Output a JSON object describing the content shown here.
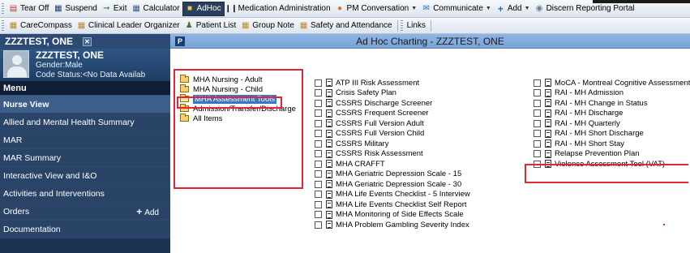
{
  "toolbar1": {
    "items": [
      {
        "label": "Tear Off",
        "icon": "tear-off-icon"
      },
      {
        "label": "Suspend",
        "icon": "suspend-icon"
      },
      {
        "label": "Exit",
        "icon": "exit-icon"
      },
      {
        "label": "Calculator",
        "icon": "calculator-icon"
      },
      {
        "label": "AdHoc",
        "icon": "adhoc-icon"
      },
      {
        "label": "Medication Administration",
        "icon": "barcode-icon"
      },
      {
        "label": "PM Conversation",
        "icon": "person-icon"
      },
      {
        "label": "Communicate",
        "icon": "envelope-icon"
      },
      {
        "label": "Add",
        "icon": "plus-icon"
      },
      {
        "label": "Discern Reporting Portal",
        "icon": "portal-icon"
      }
    ]
  },
  "toolbar2": {
    "items": [
      {
        "label": "CareCompass",
        "icon": "grid-icon"
      },
      {
        "label": "Clinical Leader Organizer",
        "icon": "grid-icon"
      },
      {
        "label": "Patient List",
        "icon": "patient-list-icon"
      },
      {
        "label": "Group Note",
        "icon": "grid-icon"
      },
      {
        "label": "Safety and Attendance",
        "icon": "grid-icon"
      }
    ],
    "links_label": "Links"
  },
  "patient": {
    "tab_name": "ZZZTEST, ONE",
    "name": "ZZZTEST, ONE",
    "gender": "Gender:Male",
    "code_status": "Code Status:<No Data Availab"
  },
  "menu": {
    "header": "Menu",
    "items": [
      {
        "label": "Nurse View",
        "selected": true
      },
      {
        "label": "Allied and Mental Health Summary"
      },
      {
        "label": "MAR"
      },
      {
        "label": "MAR Summary"
      },
      {
        "label": "Interactive View and I&O"
      },
      {
        "label": "Activities and Interventions"
      },
      {
        "label": "Orders",
        "action": "Add"
      },
      {
        "label": "Documentation"
      }
    ]
  },
  "main": {
    "title": "Ad Hoc Charting - ZZZTEST, ONE"
  },
  "folders": [
    {
      "label": "MHA Nursing - Adult"
    },
    {
      "label": "MHA Nursing - Child"
    },
    {
      "label": "MHA Assessment Tools",
      "selected": true
    },
    {
      "label": "Admission/Transfer/Discharge"
    },
    {
      "label": "All Items"
    }
  ],
  "forms_col1": [
    "ATP III Risk Assessment",
    "Crisis Safety Plan",
    "CSSRS Discharge Screener",
    "CSSRS Frequent Screener",
    "CSSRS Full Version Adult",
    "CSSRS Full Version Child",
    "CSSRS Military",
    "CSSRS Risk Assessment",
    "MHA CRAFFT",
    "MHA Geriatric Depression Scale - 15",
    "MHA Geriatric Depression Scale - 30",
    "MHA Life Events Checklist - 5 Interview",
    "MHA Life Events Checklist Self Report",
    "MHA Monitoring of Side Effects Scale",
    "MHA Problem Gambling Severity Index"
  ],
  "forms_col2": [
    "MoCA - Montreal Cognitive Assessment",
    "RAI - MH Admission",
    "RAI - MH Change in Status",
    "RAI - MH Discharge",
    "RAI - MH Quarterly",
    "RAI - MH Short Discharge",
    "RAI - MH Short Stay",
    "Relapse Prevention Plan",
    "Violence Assessment Tool (VAT)"
  ]
}
